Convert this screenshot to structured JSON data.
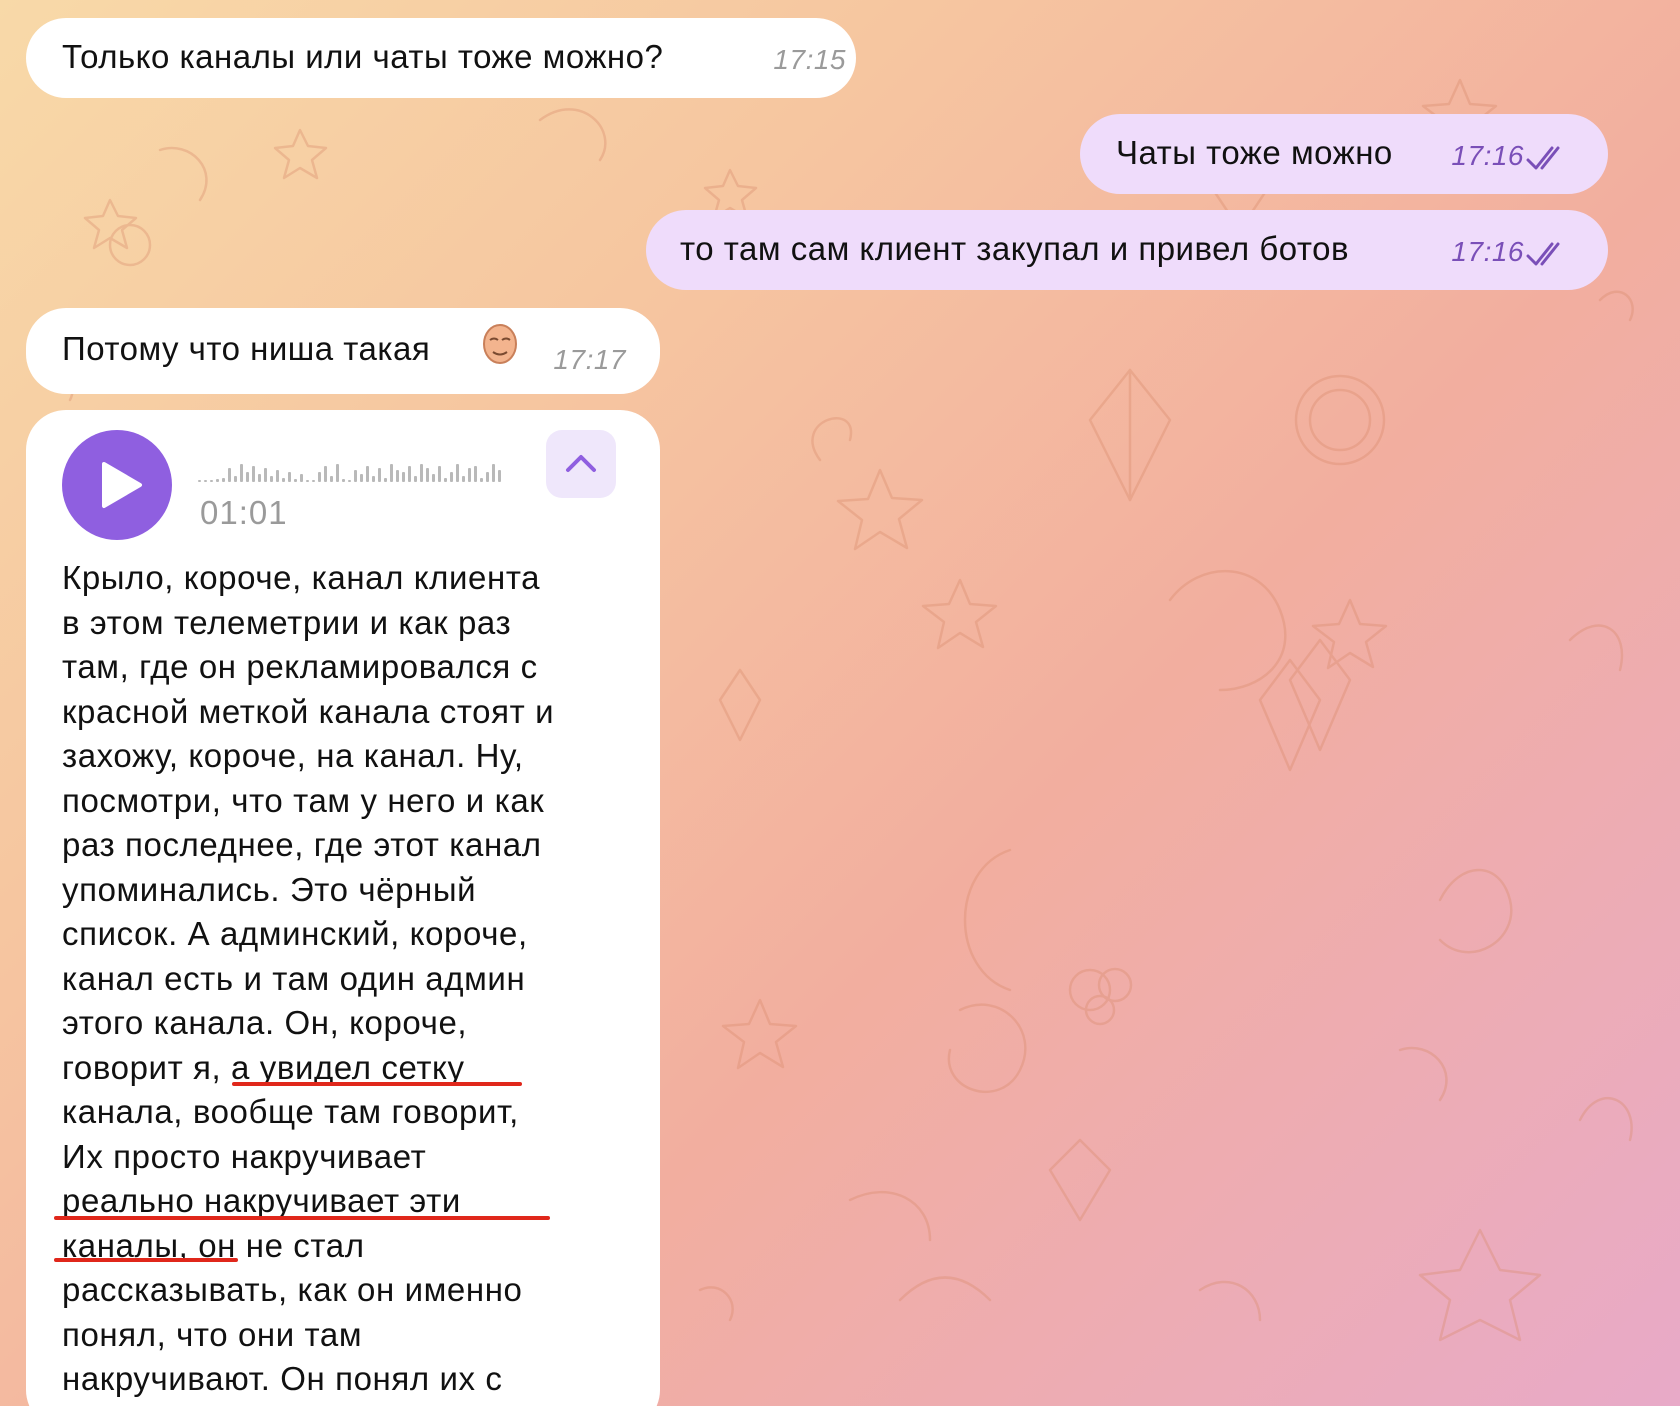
{
  "messages": [
    {
      "text": "Только каналы или чаты тоже можно?",
      "time": "17:15",
      "direction": "incoming"
    },
    {
      "text": "Чаты тоже можно",
      "time": "17:16",
      "direction": "outgoing",
      "status": "read"
    },
    {
      "text": "то там сам клиент закупал и привел ботов",
      "time": "17:16",
      "direction": "outgoing",
      "status": "read"
    },
    {
      "text": "Потому что ниша такая",
      "emoji": "face-emoji",
      "time": "17:17",
      "direction": "incoming"
    }
  ],
  "voice_message": {
    "duration": "01:01",
    "play_icon": "play-icon",
    "collapse_icon": "chevron-up-icon",
    "transcript": "Крыло, короче, канал клиента\nв этом телеметрии и как раз\nтам, где он рекламировался с\nкрасной меткой канала стоят и\nзахожу, короче, на канал. Ну,\nпосмотри, что там у него и как\nраз последнее, где этот канал\nупоминались. Это чёрный\nсписок. А админский, короче,\nканал есть и там один админ\nэтого канала. Он, короче,\nговорит я, а увидел сетку\nканала, вообще там говорит,\nИх просто накручивает\nреально накручивает эти\nканалы, он не стал\nрассказывать, как он именно\nпонял, что они там\nнакручивают. Он понял их с"
  },
  "colors": {
    "incoming_bubble": "#ffffff",
    "outgoing_bubble": "#efdcfb",
    "accent": "#8f5fe0",
    "highlight_underline": "#e0271b"
  }
}
